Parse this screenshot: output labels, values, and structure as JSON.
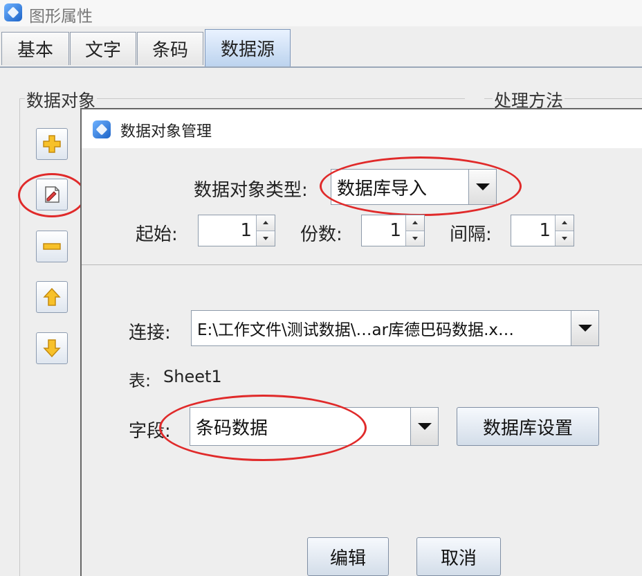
{
  "window": {
    "title": "图形属性"
  },
  "tabs": [
    {
      "label": "基本"
    },
    {
      "label": "文字"
    },
    {
      "label": "条码"
    },
    {
      "label": "数据源",
      "active": true
    }
  ],
  "panel": {
    "data_object_title": "数据对象",
    "processing_title": "处理方法"
  },
  "side_buttons": [
    "add-icon",
    "edit-icon",
    "remove-icon",
    "move-up-icon",
    "move-down-icon"
  ],
  "dialog": {
    "title": "数据对象管理",
    "type_label": "数据对象类型:",
    "type_value": "数据库导入",
    "start_label": "起始:",
    "start_value": "1",
    "copies_label": "份数:",
    "copies_value": "1",
    "interval_label": "间隔:",
    "interval_value": "1",
    "connection_label": "连接:",
    "connection_value": "E:\\工作文件\\测试数据\\…ar库德巴码数据.x…",
    "table_label": "表:",
    "table_value": "Sheet1",
    "field_label": "字段:",
    "field_value": "条码数据",
    "db_settings_button": "数据库设置",
    "edit_button": "编辑",
    "cancel_button": "取消"
  },
  "colors": {
    "highlight": "#e02a2a",
    "tab_active": "#bcd3ee",
    "accent": "#1c63c7"
  }
}
